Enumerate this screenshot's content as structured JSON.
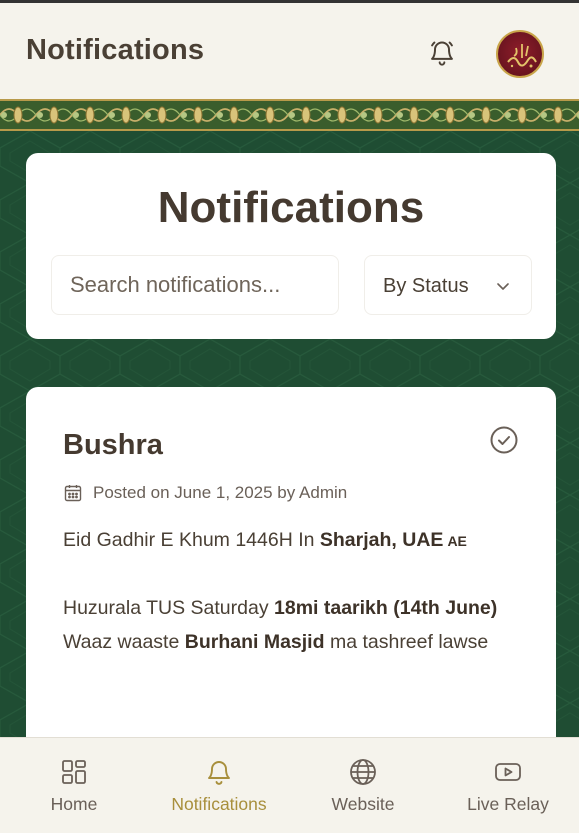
{
  "header": {
    "title": "Notifications",
    "bell_icon": "bell-icon",
    "avatar_alt": "user-avatar"
  },
  "search_card": {
    "heading": "Notifications",
    "search_placeholder": "Search notifications...",
    "status_filter": "By Status"
  },
  "notification": {
    "name": "Bushra",
    "posted": "Posted on June 1, 2025 by Admin",
    "line1_prefix": "Eid Gadhir E Khum 1446H In ",
    "line1_bold": "Sharjah, UAE",
    "line1_flag": "AE",
    "line2_prefix": "Huzurala TUS Saturday ",
    "line2_bold1": "18mi taarikh (14th June)",
    "line2_mid": " Waaz waaste ",
    "line2_bold2": "Burhani Masjid",
    "line2_suffix": " ma tashreef lawse"
  },
  "bottom_nav": {
    "items": [
      {
        "label": "Home",
        "icon": "grid-icon"
      },
      {
        "label": "Notifications",
        "icon": "bell-icon",
        "active": true
      },
      {
        "label": "Website",
        "icon": "globe-icon"
      },
      {
        "label": "Live Relay",
        "icon": "youtube-icon"
      }
    ]
  },
  "colors": {
    "accent": "#a88f3c",
    "background_green": "#1f4d33",
    "text_dark": "#453a30"
  }
}
